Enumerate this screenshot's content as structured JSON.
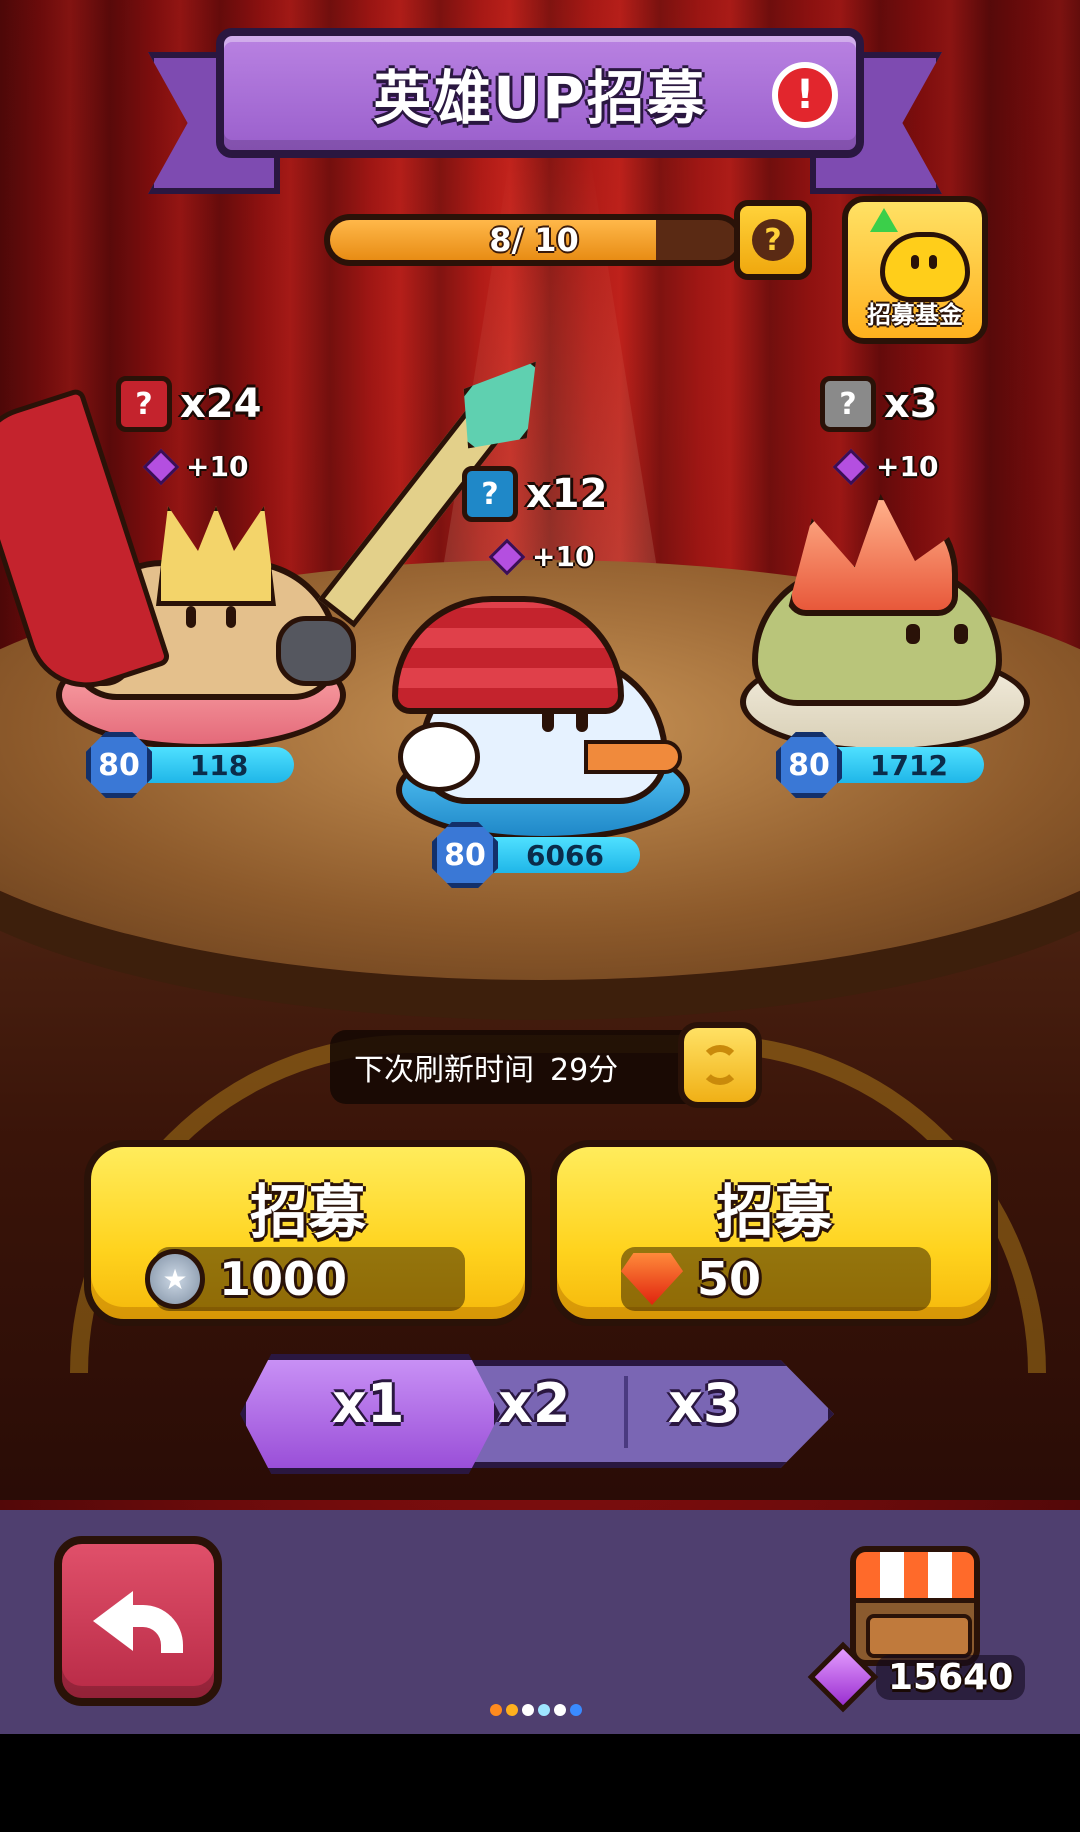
{
  "title": "英雄UP招募",
  "progress": {
    "text": "8/ 10",
    "current": 8,
    "max": 10
  },
  "fund": {
    "label": "招募基金"
  },
  "heroes": [
    {
      "name": "knight",
      "count": "x24",
      "bonus": "+10",
      "level": "80",
      "power": "118",
      "frame_color": "#c4232d"
    },
    {
      "name": "snowman",
      "count": "x12",
      "bonus": "+10",
      "level": "80",
      "power": "6066",
      "frame_color": "#1f88c8"
    },
    {
      "name": "slime",
      "count": "x3",
      "bonus": "+10",
      "level": "80",
      "power": "1712",
      "frame_color": "#8a8a8a"
    }
  ],
  "refresh": {
    "label": "下次刷新时间",
    "time": "29分"
  },
  "recruit": [
    {
      "label": "招募",
      "cost": "1000",
      "currency_icon": "coin-icon"
    },
    {
      "label": "招募",
      "cost": "50",
      "currency_icon": "ruby-icon"
    }
  ],
  "multipliers": [
    "x1",
    "x2",
    "x3"
  ],
  "selected_multiplier": "x1",
  "gems_total": "15640",
  "page_dots": [
    "#ff8a1e",
    "#ffb01e",
    "#ffffff",
    "#9fe6ff",
    "#ffffff",
    "#3a8bff"
  ]
}
